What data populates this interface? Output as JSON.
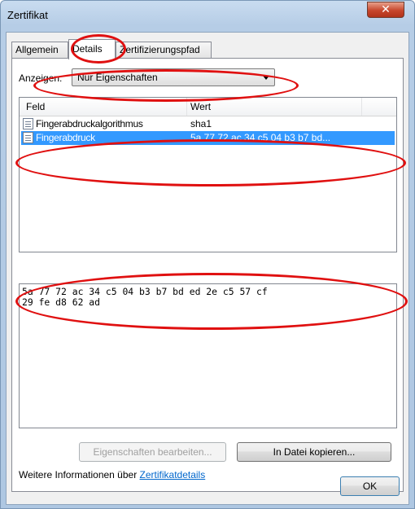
{
  "window": {
    "title": "Zertifikat",
    "close_glyph": "✕"
  },
  "tabs": [
    {
      "label": "Allgemein"
    },
    {
      "label": "Details"
    },
    {
      "label": "Zertifizierungspfad"
    }
  ],
  "details": {
    "show_label": "Anzeigen:",
    "show_selected": "Nur Eigenschaften",
    "list": {
      "columns": [
        "Feld",
        "Wert"
      ],
      "rows": [
        {
          "field": "Fingerabdruckalgorithmus",
          "value": "sha1",
          "selected": false
        },
        {
          "field": "Fingerabdruck",
          "value": "5a 77 72 ac 34 c5 04 b3 b7 bd...",
          "selected": true
        }
      ]
    },
    "value_text": "5a 77 72 ac 34 c5 04 b3 b7 bd ed 2e c5 57 cf\n29 fe d8 62 ad",
    "edit_button": "Eigenschaften bearbeiten...",
    "copy_button": "In Datei kopieren...",
    "info_text": "Weitere Informationen über ",
    "info_link": "Zertifikatdetails"
  },
  "footer": {
    "ok_button": "OK"
  },
  "colors": {
    "highlight": "#3399ff",
    "annotation": "#e01010",
    "link": "#0066cc"
  }
}
